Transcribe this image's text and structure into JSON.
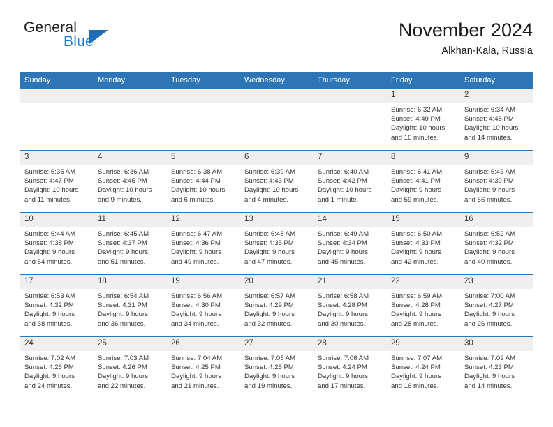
{
  "brand": {
    "name_part1": "General",
    "name_part2": "Blue",
    "triangle_color": "#1f6cb4",
    "blue_text_color": "#1a76c8"
  },
  "header": {
    "title": "November 2024",
    "subtitle": "Alkhan-Kala, Russia"
  },
  "theme": {
    "header_blue": "#2e75b6",
    "daynum_band": "#efefef",
    "text": "#333333"
  },
  "weekday_headers": [
    "Sunday",
    "Monday",
    "Tuesday",
    "Wednesday",
    "Thursday",
    "Friday",
    "Saturday"
  ],
  "labels": {
    "sunrise_prefix": "Sunrise:",
    "sunset_prefix": "Sunset:",
    "daylight_prefix": "Daylight:"
  },
  "weeks": [
    [
      {
        "day": "",
        "blank": true
      },
      {
        "day": "",
        "blank": true
      },
      {
        "day": "",
        "blank": true
      },
      {
        "day": "",
        "blank": true
      },
      {
        "day": "",
        "blank": true
      },
      {
        "day": "1",
        "sunrise": "Sunrise: 6:32 AM",
        "sunset": "Sunset: 4:49 PM",
        "daylight_line1": "Daylight: 10 hours",
        "daylight_line2": "and 16 minutes."
      },
      {
        "day": "2",
        "sunrise": "Sunrise: 6:34 AM",
        "sunset": "Sunset: 4:48 PM",
        "daylight_line1": "Daylight: 10 hours",
        "daylight_line2": "and 14 minutes."
      }
    ],
    [
      {
        "day": "3",
        "sunrise": "Sunrise: 6:35 AM",
        "sunset": "Sunset: 4:47 PM",
        "daylight_line1": "Daylight: 10 hours",
        "daylight_line2": "and 11 minutes."
      },
      {
        "day": "4",
        "sunrise": "Sunrise: 6:36 AM",
        "sunset": "Sunset: 4:45 PM",
        "daylight_line1": "Daylight: 10 hours",
        "daylight_line2": "and 9 minutes."
      },
      {
        "day": "5",
        "sunrise": "Sunrise: 6:38 AM",
        "sunset": "Sunset: 4:44 PM",
        "daylight_line1": "Daylight: 10 hours",
        "daylight_line2": "and 6 minutes."
      },
      {
        "day": "6",
        "sunrise": "Sunrise: 6:39 AM",
        "sunset": "Sunset: 4:43 PM",
        "daylight_line1": "Daylight: 10 hours",
        "daylight_line2": "and 4 minutes."
      },
      {
        "day": "7",
        "sunrise": "Sunrise: 6:40 AM",
        "sunset": "Sunset: 4:42 PM",
        "daylight_line1": "Daylight: 10 hours",
        "daylight_line2": "and 1 minute."
      },
      {
        "day": "8",
        "sunrise": "Sunrise: 6:41 AM",
        "sunset": "Sunset: 4:41 PM",
        "daylight_line1": "Daylight: 9 hours",
        "daylight_line2": "and 59 minutes."
      },
      {
        "day": "9",
        "sunrise": "Sunrise: 6:43 AM",
        "sunset": "Sunset: 4:39 PM",
        "daylight_line1": "Daylight: 9 hours",
        "daylight_line2": "and 56 minutes."
      }
    ],
    [
      {
        "day": "10",
        "sunrise": "Sunrise: 6:44 AM",
        "sunset": "Sunset: 4:38 PM",
        "daylight_line1": "Daylight: 9 hours",
        "daylight_line2": "and 54 minutes."
      },
      {
        "day": "11",
        "sunrise": "Sunrise: 6:45 AM",
        "sunset": "Sunset: 4:37 PM",
        "daylight_line1": "Daylight: 9 hours",
        "daylight_line2": "and 51 minutes."
      },
      {
        "day": "12",
        "sunrise": "Sunrise: 6:47 AM",
        "sunset": "Sunset: 4:36 PM",
        "daylight_line1": "Daylight: 9 hours",
        "daylight_line2": "and 49 minutes."
      },
      {
        "day": "13",
        "sunrise": "Sunrise: 6:48 AM",
        "sunset": "Sunset: 4:35 PM",
        "daylight_line1": "Daylight: 9 hours",
        "daylight_line2": "and 47 minutes."
      },
      {
        "day": "14",
        "sunrise": "Sunrise: 6:49 AM",
        "sunset": "Sunset: 4:34 PM",
        "daylight_line1": "Daylight: 9 hours",
        "daylight_line2": "and 45 minutes."
      },
      {
        "day": "15",
        "sunrise": "Sunrise: 6:50 AM",
        "sunset": "Sunset: 4:33 PM",
        "daylight_line1": "Daylight: 9 hours",
        "daylight_line2": "and 42 minutes."
      },
      {
        "day": "16",
        "sunrise": "Sunrise: 6:52 AM",
        "sunset": "Sunset: 4:32 PM",
        "daylight_line1": "Daylight: 9 hours",
        "daylight_line2": "and 40 minutes."
      }
    ],
    [
      {
        "day": "17",
        "sunrise": "Sunrise: 6:53 AM",
        "sunset": "Sunset: 4:32 PM",
        "daylight_line1": "Daylight: 9 hours",
        "daylight_line2": "and 38 minutes."
      },
      {
        "day": "18",
        "sunrise": "Sunrise: 6:54 AM",
        "sunset": "Sunset: 4:31 PM",
        "daylight_line1": "Daylight: 9 hours",
        "daylight_line2": "and 36 minutes."
      },
      {
        "day": "19",
        "sunrise": "Sunrise: 6:56 AM",
        "sunset": "Sunset: 4:30 PM",
        "daylight_line1": "Daylight: 9 hours",
        "daylight_line2": "and 34 minutes."
      },
      {
        "day": "20",
        "sunrise": "Sunrise: 6:57 AM",
        "sunset": "Sunset: 4:29 PM",
        "daylight_line1": "Daylight: 9 hours",
        "daylight_line2": "and 32 minutes."
      },
      {
        "day": "21",
        "sunrise": "Sunrise: 6:58 AM",
        "sunset": "Sunset: 4:28 PM",
        "daylight_line1": "Daylight: 9 hours",
        "daylight_line2": "and 30 minutes."
      },
      {
        "day": "22",
        "sunrise": "Sunrise: 6:59 AM",
        "sunset": "Sunset: 4:28 PM",
        "daylight_line1": "Daylight: 9 hours",
        "daylight_line2": "and 28 minutes."
      },
      {
        "day": "23",
        "sunrise": "Sunrise: 7:00 AM",
        "sunset": "Sunset: 4:27 PM",
        "daylight_line1": "Daylight: 9 hours",
        "daylight_line2": "and 26 minutes."
      }
    ],
    [
      {
        "day": "24",
        "sunrise": "Sunrise: 7:02 AM",
        "sunset": "Sunset: 4:26 PM",
        "daylight_line1": "Daylight: 9 hours",
        "daylight_line2": "and 24 minutes."
      },
      {
        "day": "25",
        "sunrise": "Sunrise: 7:03 AM",
        "sunset": "Sunset: 4:26 PM",
        "daylight_line1": "Daylight: 9 hours",
        "daylight_line2": "and 22 minutes."
      },
      {
        "day": "26",
        "sunrise": "Sunrise: 7:04 AM",
        "sunset": "Sunset: 4:25 PM",
        "daylight_line1": "Daylight: 9 hours",
        "daylight_line2": "and 21 minutes."
      },
      {
        "day": "27",
        "sunrise": "Sunrise: 7:05 AM",
        "sunset": "Sunset: 4:25 PM",
        "daylight_line1": "Daylight: 9 hours",
        "daylight_line2": "and 19 minutes."
      },
      {
        "day": "28",
        "sunrise": "Sunrise: 7:06 AM",
        "sunset": "Sunset: 4:24 PM",
        "daylight_line1": "Daylight: 9 hours",
        "daylight_line2": "and 17 minutes."
      },
      {
        "day": "29",
        "sunrise": "Sunrise: 7:07 AM",
        "sunset": "Sunset: 4:24 PM",
        "daylight_line1": "Daylight: 9 hours",
        "daylight_line2": "and 16 minutes."
      },
      {
        "day": "30",
        "sunrise": "Sunrise: 7:09 AM",
        "sunset": "Sunset: 4:23 PM",
        "daylight_line1": "Daylight: 9 hours",
        "daylight_line2": "and 14 minutes."
      }
    ]
  ]
}
